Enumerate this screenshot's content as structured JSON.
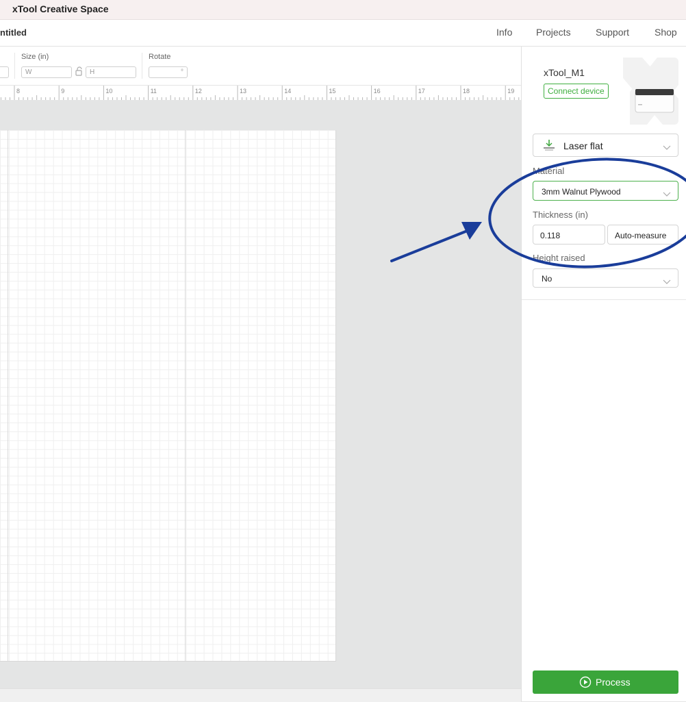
{
  "app": {
    "title": "xTool Creative Space",
    "document_name": "ntitled"
  },
  "nav": {
    "items": [
      "Info",
      "Projects",
      "Support",
      "Shop"
    ]
  },
  "props": {
    "size_label": "Size (in)",
    "rotate_label": "Rotate",
    "width_placeholder": "W",
    "height_placeholder": "H",
    "rotate_unit": "°"
  },
  "ruler": {
    "ticks": [
      "8",
      "9",
      "10",
      "11",
      "12",
      "13",
      "14",
      "15",
      "16",
      "17",
      "18",
      "19"
    ]
  },
  "device": {
    "name": "xTool_M1",
    "connect_label": "Connect device"
  },
  "mode": {
    "selected": "Laser flat"
  },
  "material": {
    "label": "Material",
    "selected": "3mm Walnut Plywood"
  },
  "thickness": {
    "label": "Thickness (in)",
    "value": "0.118",
    "auto_label": "Auto-measure"
  },
  "height_raised": {
    "label": "Height raised",
    "selected": "No"
  },
  "process": {
    "label": "Process"
  },
  "annotation": {
    "color": "#1a3d9a"
  }
}
